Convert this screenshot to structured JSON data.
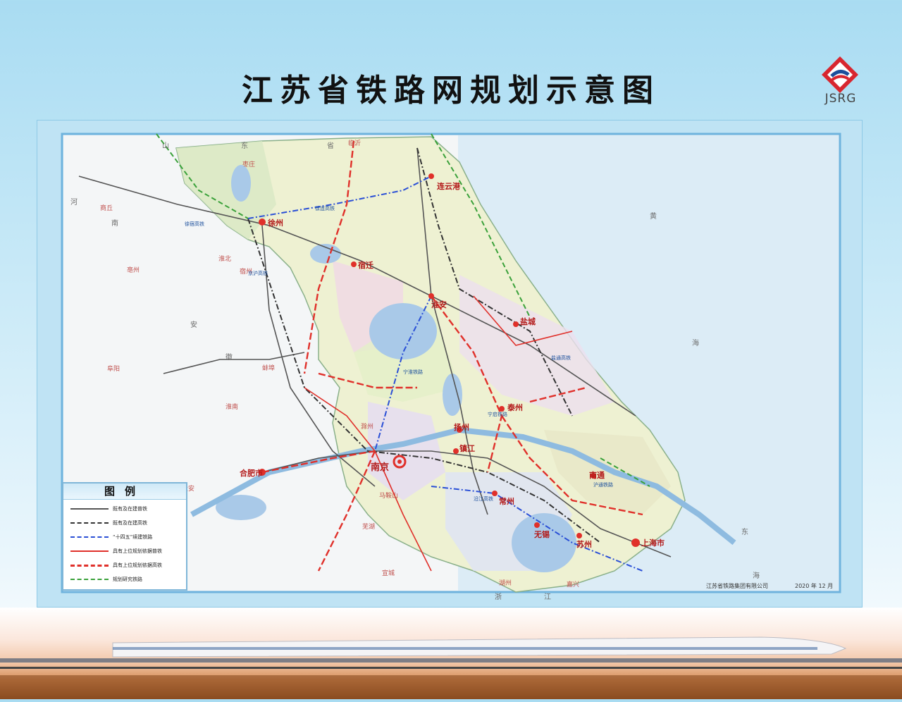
{
  "title": "江苏省铁路网规划示意图",
  "logo": {
    "text": "JSRG",
    "icon": "jsrg-logo-icon",
    "accent": "#d8262f"
  },
  "legend": {
    "title": "图例",
    "items": [
      {
        "label": "既有及在建普铁",
        "color": "#555555",
        "style": "solid"
      },
      {
        "label": "既有及在建高铁",
        "color": "#333333",
        "style": "dashdot"
      },
      {
        "label": "“十四五”续建铁路",
        "color": "#2a4fd6",
        "style": "dashdot"
      },
      {
        "label": "具有上位规划依据普铁",
        "color": "#e0302a",
        "style": "solid"
      },
      {
        "label": "具有上位规划依据高铁",
        "color": "#e0302a",
        "style": "dashed"
      },
      {
        "label": "规划研究铁路",
        "color": "#3aa13a",
        "style": "dashed"
      }
    ]
  },
  "cities": {
    "lianyungang": "连云港",
    "xuzhou": "徐州",
    "suqian": "宿迁",
    "huaian": "淮安",
    "yancheng": "盐城",
    "yangzhou": "扬州",
    "taizhou": "泰州",
    "nanjing": "南京",
    "zhenjiang": "镇江",
    "changzhou": "常州",
    "wuxi": "无锡",
    "suzhou": "苏州",
    "nantong": "南通",
    "shanghai": "上海市",
    "hefei": "合肥市"
  },
  "places": {
    "linyi": "临沂",
    "zaozhuang": "枣庄",
    "shang": "商丘",
    "huaibei": "淮北",
    "suzhou_ah": "宿州",
    "bengbu": "蚌埠",
    "huainan": "淮南",
    "chuzhou": "滁州",
    "maanshan": "马鞍山",
    "wuhu": "芜湖",
    "xuancheng": "宣城",
    "huzhou": "湖州",
    "jiaxing": "嘉兴",
    "liuan": "六安",
    "fuyang": "阜阳",
    "bozhou": "亳州",
    "shan": "山",
    "dong": "东",
    "sheng": "省",
    "he": "河",
    "nan": "南",
    "an": "安",
    "hui": "徽",
    "huang": "黄",
    "hai": "海",
    "dong2": "东",
    "hai2": "海",
    "zhe": "浙",
    "jiang": "江"
  },
  "lines": {
    "xulian_hsr": "徐连高铁",
    "xusu_hsr": "徐宿高铁",
    "jinghu_hsr": "京沪高铁",
    "ninghuai": "宁淮铁路",
    "xiangtong": "沿江高铁",
    "ningqi": "宁启铁路",
    "huhai": "沪通铁路",
    "hudong": "盐通高铁"
  },
  "footer": {
    "company": "江苏省铁路集团有限公司",
    "date": "2020 年 12 月"
  },
  "colors": {
    "sea": "#dcecf6",
    "jiangsu_land": "#eef1d2",
    "lake": "#a9c9e8",
    "rail_existing": "#555555",
    "rail_hsr": "#333333",
    "rail_14th": "#2a4fd6",
    "rail_plan_red": "#e0302a",
    "rail_study_green": "#3aa13a"
  }
}
